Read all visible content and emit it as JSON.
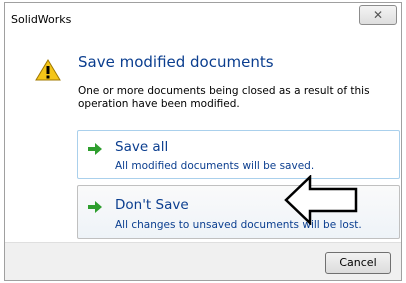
{
  "window": {
    "title": "SolidWorks",
    "close_label": "☒"
  },
  "dialog": {
    "heading": "Save modified documents",
    "message": "One or more documents being closed as a result of this operation have been modified."
  },
  "options": [
    {
      "title": "Save all",
      "description": "All modified documents will be saved."
    },
    {
      "title": "Don't Save",
      "description": "All changes to unsaved documents will be lost."
    }
  ],
  "footer": {
    "cancel_label": "Cancel"
  },
  "colors": {
    "accent_text": "#0b3e8f",
    "arrow_green": "#2e9e2e",
    "warning_yellow": "#f4c518"
  },
  "icons": {
    "warning": "warning-icon",
    "option_arrow": "green-arrow-icon",
    "annotation": "pointer-arrow-icon"
  }
}
